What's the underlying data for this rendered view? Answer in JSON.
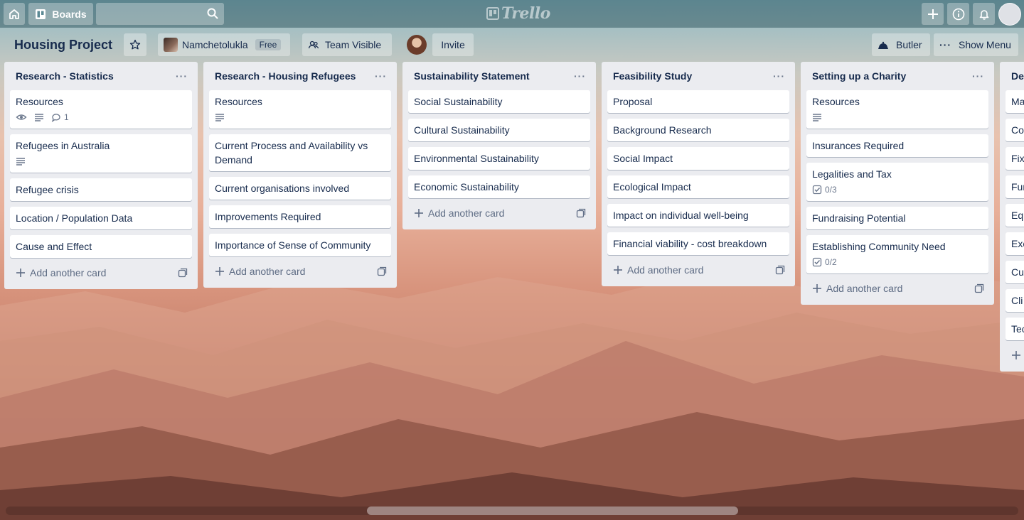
{
  "header": {
    "boards_label": "Boards",
    "logo_text": "Trello"
  },
  "board": {
    "title": "Housing Project",
    "team_name": "Namchetolukla",
    "team_badge": "Free",
    "visibility": "Team Visible",
    "invite_label": "Invite",
    "butler_label": "Butler",
    "show_menu_label": "Show Menu"
  },
  "add_card_label": "Add another card",
  "lists": [
    {
      "title": "Research - Statistics",
      "cards": [
        {
          "title": "Resources",
          "watch": true,
          "description": true,
          "comments": "1"
        },
        {
          "title": "Refugees in Australia",
          "description": true
        },
        {
          "title": "Refugee crisis"
        },
        {
          "title": "Location / Population Data"
        },
        {
          "title": "Cause and Effect"
        }
      ]
    },
    {
      "title": "Research - Housing Refugees",
      "cards": [
        {
          "title": "Resources",
          "description": true
        },
        {
          "title": "Current Process and Availability vs Demand"
        },
        {
          "title": "Current organisations involved"
        },
        {
          "title": "Improvements Required"
        },
        {
          "title": "Importance of Sense of Community"
        }
      ]
    },
    {
      "title": "Sustainability Statement",
      "cards": [
        {
          "title": "Social Sustainability"
        },
        {
          "title": "Cultural Sustainability"
        },
        {
          "title": "Environmental Sustainability"
        },
        {
          "title": "Economic Sustainability"
        }
      ]
    },
    {
      "title": "Feasibility Study",
      "cards": [
        {
          "title": "Proposal"
        },
        {
          "title": "Background Research"
        },
        {
          "title": "Social Impact"
        },
        {
          "title": "Ecological Impact"
        },
        {
          "title": "Impact on individual well-being"
        },
        {
          "title": "Financial viability - cost breakdown"
        }
      ]
    },
    {
      "title": "Setting up a Charity",
      "cards": [
        {
          "title": "Resources",
          "description": true
        },
        {
          "title": "Insurances Required"
        },
        {
          "title": "Legalities and Tax",
          "checklist": "0/3"
        },
        {
          "title": "Fundraising Potential"
        },
        {
          "title": "Establishing Community Need",
          "checklist": "0/2"
        }
      ]
    },
    {
      "title": "De",
      "partial": true,
      "cards": [
        {
          "title": "Ma"
        },
        {
          "title": "Co"
        },
        {
          "title": "Fix"
        },
        {
          "title": "Fur"
        },
        {
          "title": "Eq"
        },
        {
          "title": "Exe"
        },
        {
          "title": "Cu"
        },
        {
          "title": "Cli"
        },
        {
          "title": "Tec"
        }
      ]
    }
  ]
}
